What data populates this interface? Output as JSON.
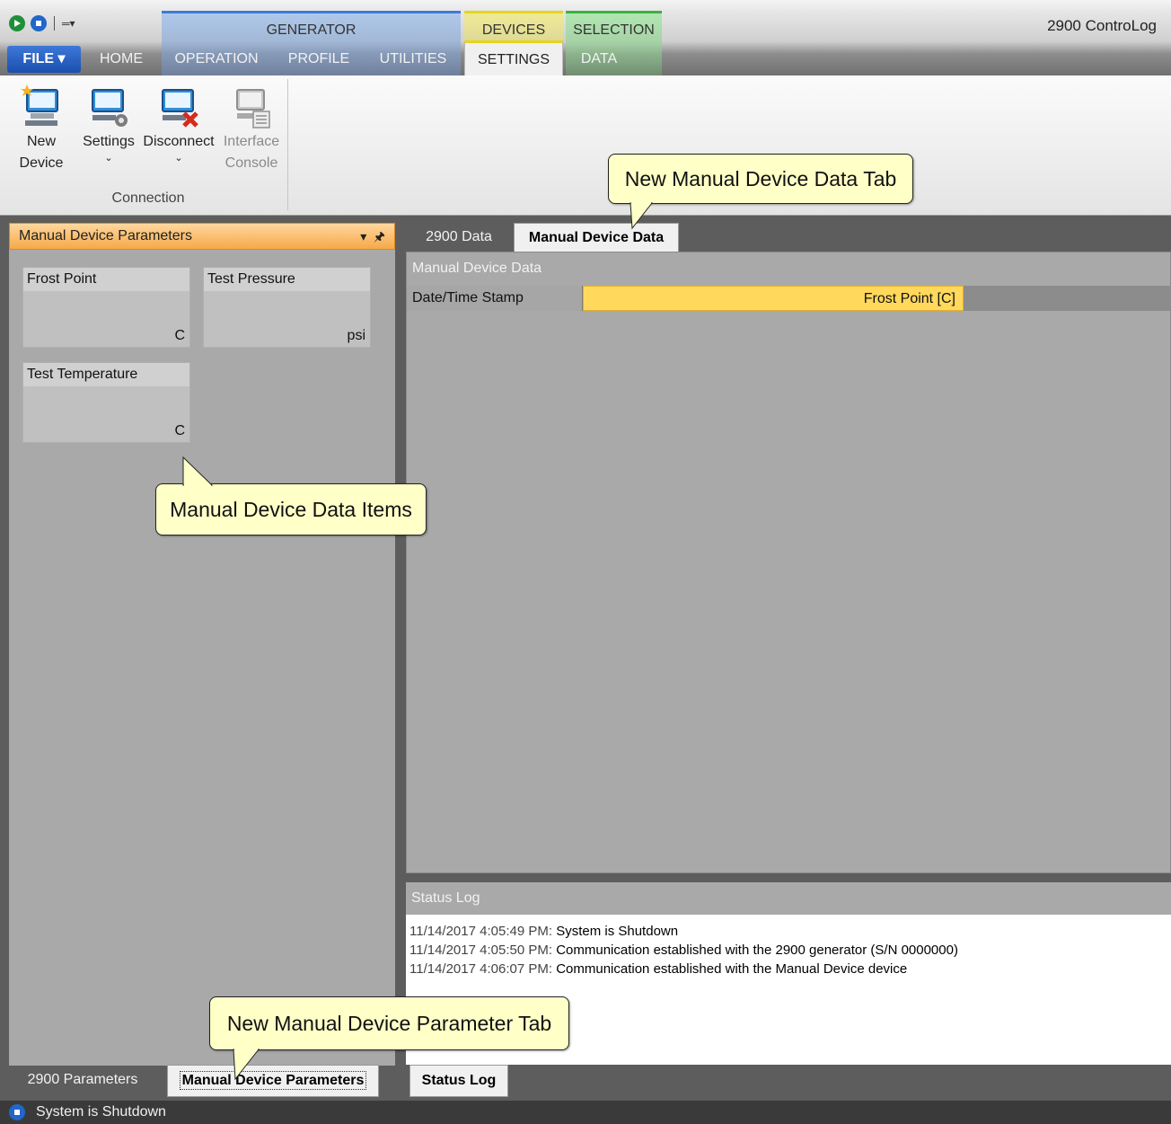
{
  "app": {
    "title": "2900 ControLog"
  },
  "ribbon": {
    "file_label": "FILE",
    "tabs": [
      "HOME",
      "OPERATION",
      "PROFILE",
      "UTILITIES",
      "SETTINGS",
      "DATA"
    ],
    "contexts": [
      "GENERATOR",
      "DEVICES",
      "SELECTION"
    ],
    "buttons": [
      {
        "line1": "New",
        "line2": "Device",
        "icon": "new-device-icon"
      },
      {
        "line1": "Settings",
        "line2": "⌄",
        "icon": "settings-icon"
      },
      {
        "line1": "Disconnect",
        "line2": "⌄",
        "icon": "disconnect-icon"
      },
      {
        "line1": "Interface",
        "line2": "Console",
        "icon": "interface-console-icon"
      }
    ],
    "group_label": "Connection"
  },
  "callouts": {
    "data_tab": "New Manual Device Data Tab",
    "data_items": "Manual Device Data Items",
    "param_tab": "New Manual Device Parameter Tab"
  },
  "left_pane": {
    "header": "Manual Device Parameters",
    "tiles": [
      {
        "title": "Frost Point",
        "unit": "C"
      },
      {
        "title": "Test Pressure",
        "unit": "psi"
      },
      {
        "title": "Test Temperature",
        "unit": "C"
      }
    ],
    "bottom_tabs": [
      "2900 Parameters",
      "Manual Device Parameters"
    ]
  },
  "right_pane": {
    "doc_tabs": [
      "2900 Data",
      "Manual Device Data"
    ],
    "grid_title": "Manual Device Data",
    "columns": [
      "Date/Time Stamp",
      "Frost Point [C]"
    ],
    "status_title": "Status Log",
    "log": [
      {
        "ts": "11/14/2017 4:05:49 PM:",
        "msg": "System is Shutdown"
      },
      {
        "ts": "11/14/2017 4:05:50 PM:",
        "msg": "Communication established with the 2900 generator (S/N 0000000)"
      },
      {
        "ts": "11/14/2017 4:06:07 PM:",
        "msg": "Communication established with the Manual Device device"
      }
    ],
    "bottom_tab": "Status Log"
  },
  "statusbar": {
    "text": "System is Shutdown"
  }
}
